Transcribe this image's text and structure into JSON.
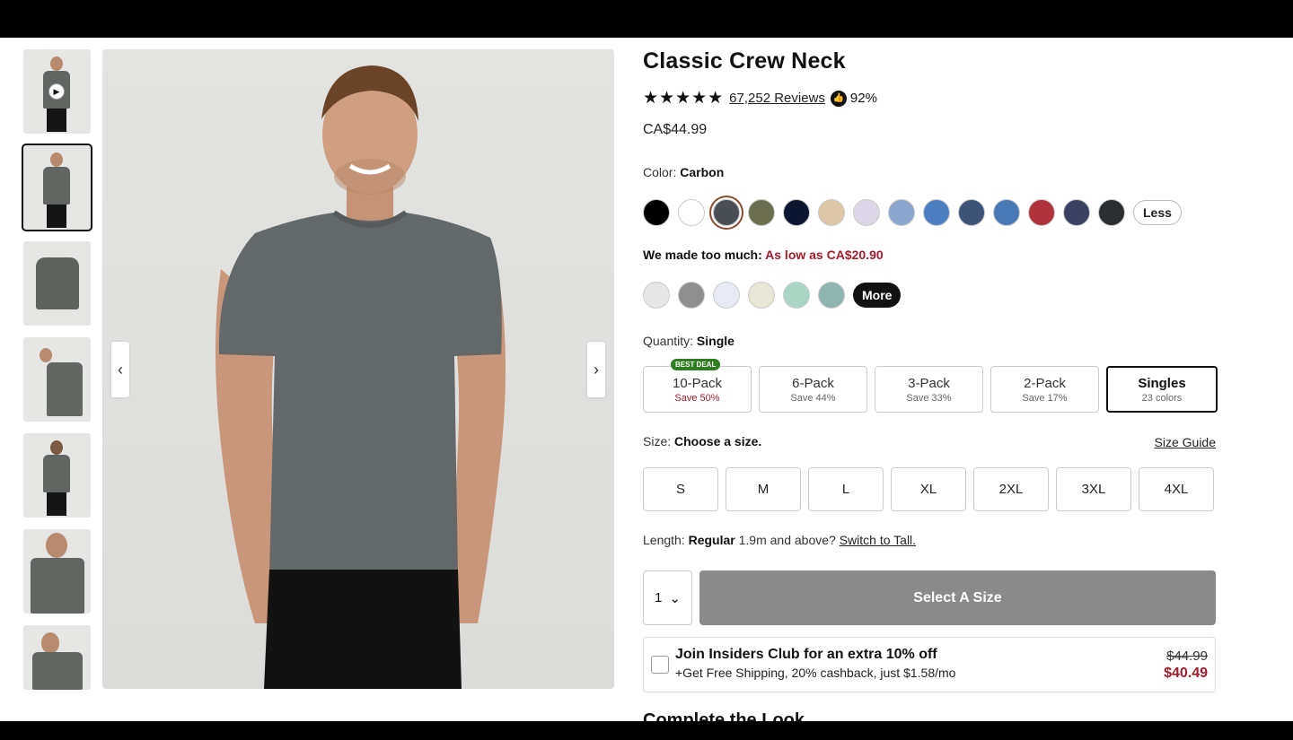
{
  "product": {
    "title": "Classic Crew Neck",
    "stars": "★★★★★",
    "rating": 4.5,
    "reviews": "67,252 Reviews",
    "recommend": "92%",
    "price": "CA$44.99"
  },
  "color": {
    "label": "Color:",
    "selected": "Carbon",
    "row1": [
      "#000000",
      "#ffffff",
      "#4a4f55",
      "#6b6e4e",
      "#0d1630",
      "#dcc7a6",
      "#dcd6e6",
      "#8aa6cf",
      "#4d7ec2",
      "#3d5378",
      "#4a79b8",
      "#b0323d",
      "#3b4261",
      "#2a2e30"
    ],
    "less_label": "Less",
    "promo_prefix": "We made too much:",
    "promo_price": "As low as CA$20.90",
    "row2": [
      "#e6e6e6",
      "#8f8f8f",
      "#e7eaf5",
      "#e8e6d6",
      "#a9d6c4",
      "#8fb5b0"
    ],
    "more_label": "More"
  },
  "quantity": {
    "label": "Quantity:",
    "selected": "Single",
    "packs": [
      {
        "name": "10-Pack",
        "sub": "Save 50%",
        "badge": "BEST DEAL"
      },
      {
        "name": "6-Pack",
        "sub": "Save 44%"
      },
      {
        "name": "3-Pack",
        "sub": "Save 33%"
      },
      {
        "name": "2-Pack",
        "sub": "Save 17%"
      },
      {
        "name": "Singles",
        "sub": "23 colors"
      }
    ]
  },
  "size": {
    "label": "Size:",
    "prompt": "Choose a size.",
    "guide": "Size Guide",
    "options": [
      "S",
      "M",
      "L",
      "XL",
      "2XL",
      "3XL",
      "4XL"
    ]
  },
  "length": {
    "label": "Length:",
    "value": "Regular",
    "question": "1.9m and above?",
    "link": "Switch to Tall."
  },
  "cart": {
    "qty": "1",
    "button": "Select A Size"
  },
  "insiders": {
    "title": "Join Insiders Club for an extra 10% off",
    "sub": "+Get Free Shipping, 20% cashback, just $1.58/mo",
    "old_price": "$44.99",
    "new_price": "$40.49"
  },
  "complete_look": "Complete the Look"
}
